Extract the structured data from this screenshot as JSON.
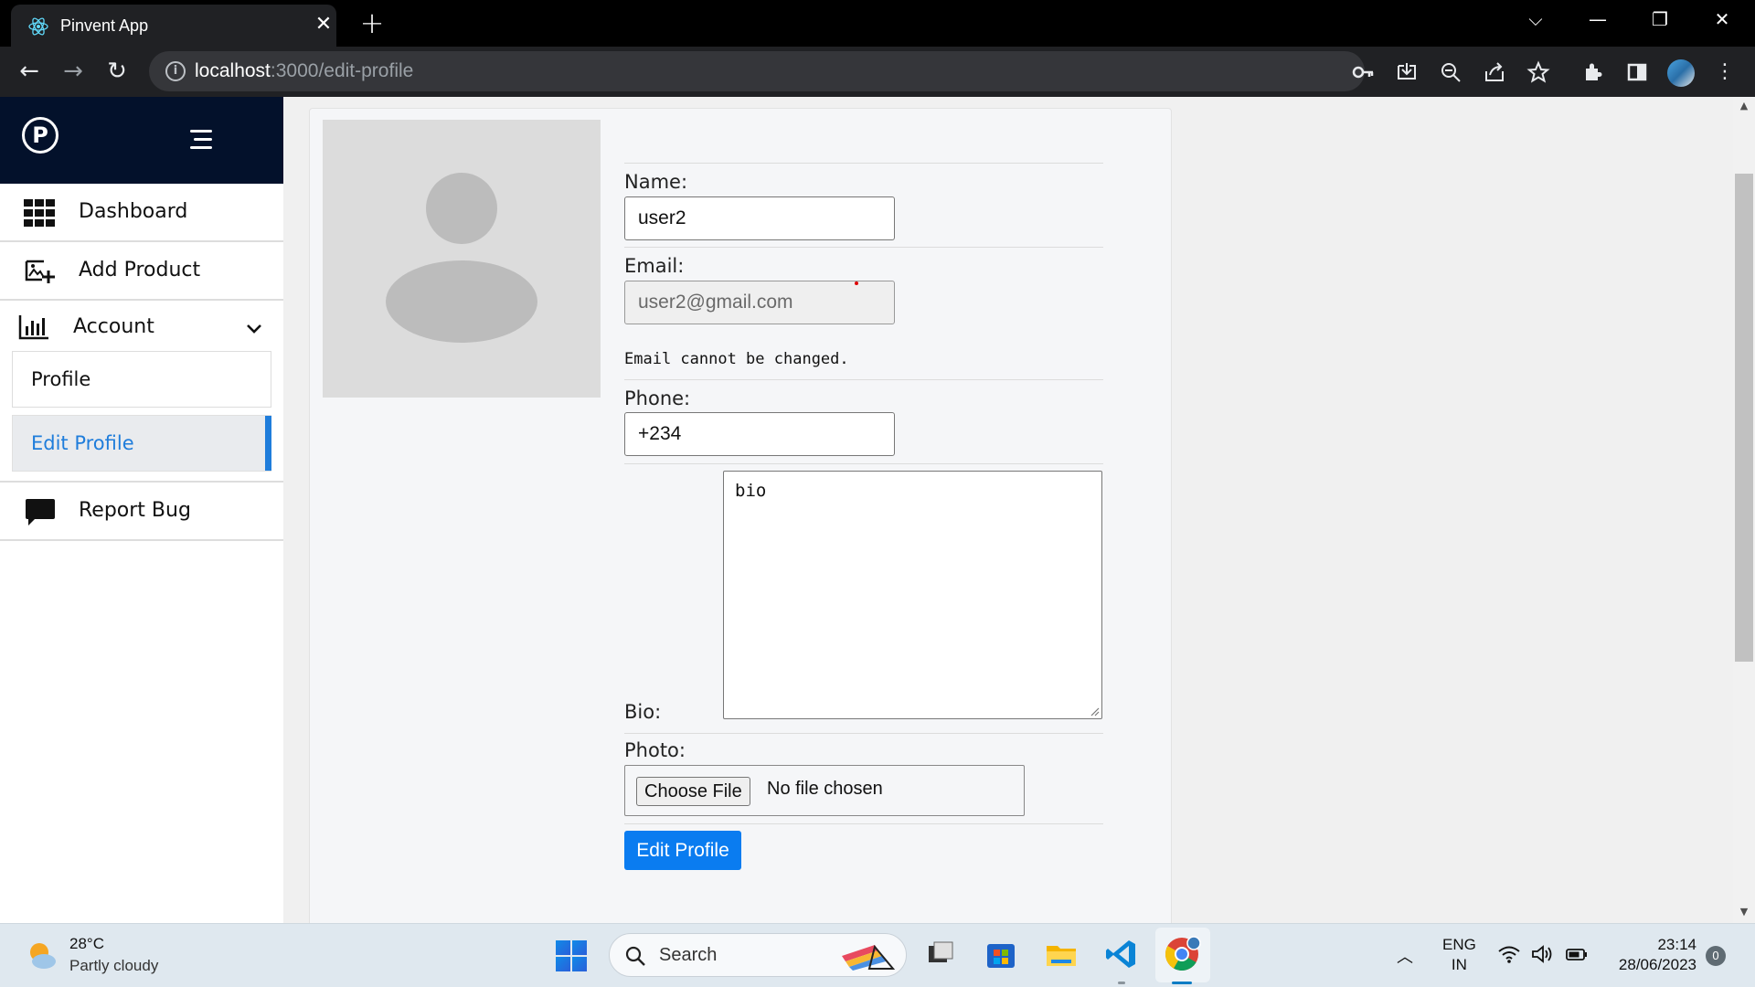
{
  "browser": {
    "tab_title": "Pinvent App",
    "tab_close": "✕",
    "new_tab": "+",
    "url_host": "localhost",
    "url_path": ":3000/edit-profile",
    "window_controls": {
      "dropdown": "⌵",
      "minimize": "—",
      "restore": "❐",
      "close": "✕"
    },
    "nav": {
      "back": "←",
      "forward": "→",
      "reload": "↻"
    }
  },
  "sidebar": {
    "logo_letter": "P",
    "items": [
      {
        "label": "Dashboard",
        "icon": "dashboard-grid-icon"
      },
      {
        "label": "Add Product",
        "icon": "add-image-icon"
      },
      {
        "label": "Account",
        "icon": "bar-chart-icon",
        "expanded": true
      },
      {
        "label": "Report Bug",
        "icon": "chat-bubble-icon"
      }
    ],
    "account_subitems": [
      {
        "label": "Profile",
        "active": false
      },
      {
        "label": "Edit Profile",
        "active": true
      }
    ]
  },
  "form": {
    "name_label": "Name:",
    "name_value": "user2",
    "email_label": "Email:",
    "email_value": "user2@gmail.com",
    "email_note": "Email cannot be changed.",
    "phone_label": "Phone:",
    "phone_value": "+234",
    "bio_label": "Bio:",
    "bio_value": "bio",
    "photo_label": "Photo:",
    "file_button": "Choose File",
    "file_status": "No file chosen",
    "submit_label": "Edit Profile"
  },
  "taskbar": {
    "weather_temp": "28°C",
    "weather_desc": "Partly cloudy",
    "search_placeholder": "Search",
    "lang_line1": "ENG",
    "lang_line2": "IN",
    "time": "23:14",
    "date": "28/06/2023",
    "notifications": "0"
  },
  "colors": {
    "sidebar_header": "#03112b",
    "accent": "#1f7ddb",
    "submit": "#0a7cf0"
  }
}
